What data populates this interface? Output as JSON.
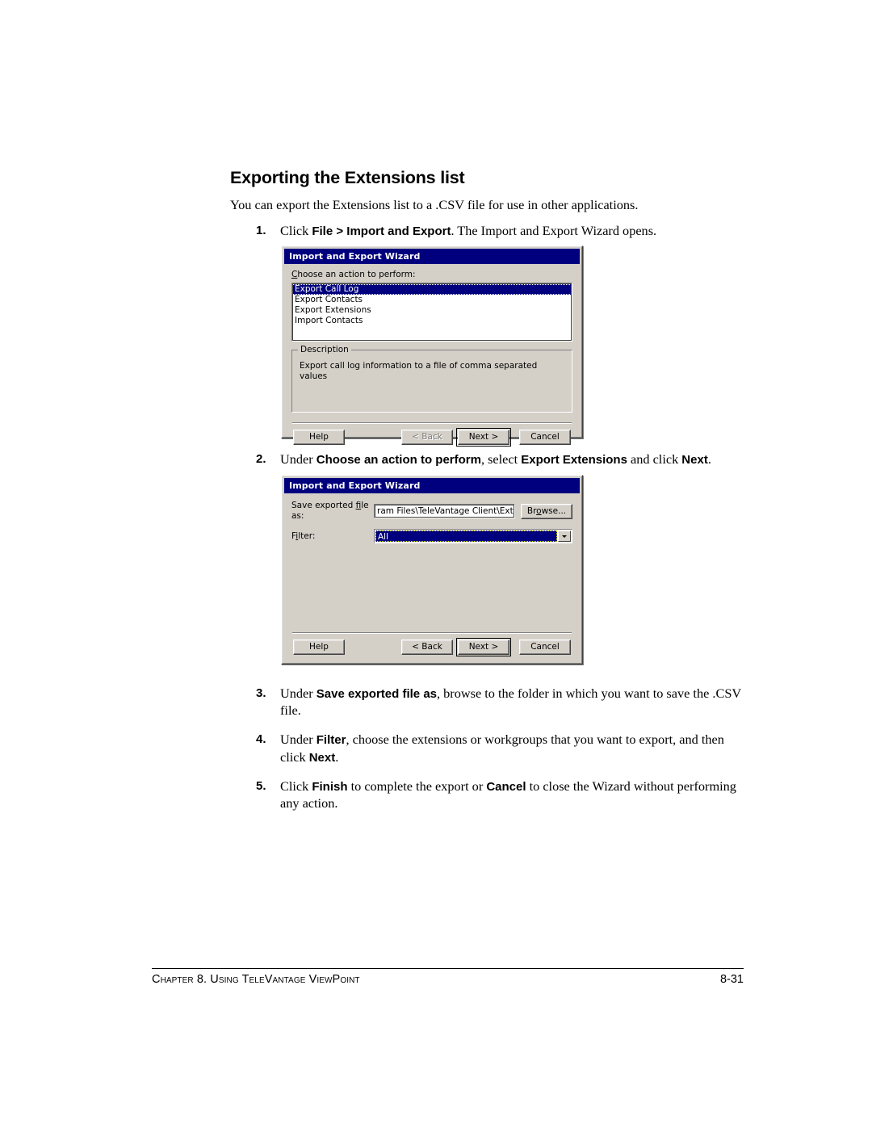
{
  "page": {
    "heading": "Exporting the Extensions list",
    "intro": "You can export the Extensions list to a .CSV file for use in other applications."
  },
  "steps": {
    "step1": {
      "num": "1.",
      "pre": "Click ",
      "bold1": "File > Import and Export",
      "post": ". The Import and Export Wizard opens."
    },
    "step2": {
      "num": "2.",
      "pre": "Under ",
      "bold1": "Choose an action to perform",
      "mid1": ", select ",
      "bold2": "Export Extensions",
      "mid2": " and click ",
      "bold3": "Next",
      "post": "."
    },
    "step3": {
      "num": "3.",
      "pre": "Under ",
      "bold1": "Save exported file as",
      "post": ", browse to the folder in which you want to save the .CSV file."
    },
    "step4": {
      "num": "4.",
      "pre": "Under ",
      "bold1": "Filter",
      "mid1": ", choose the extensions or workgroups that you want to export, and then click ",
      "bold2": "Next",
      "post": "."
    },
    "step5": {
      "num": "5.",
      "pre": "Click ",
      "bold1": "Finish",
      "mid1": " to complete the export or ",
      "bold2": "Cancel",
      "post": " to close the Wizard without performing any action."
    }
  },
  "dialog1": {
    "title": "Import and Export Wizard",
    "action_label": "Choose an action to perform:",
    "action_label_mnemonic": "C",
    "action_label_rest": "hoose an action to perform:",
    "list_items": [
      {
        "label": "Export Call Log",
        "selected": true
      },
      {
        "label": "Export Contacts",
        "selected": false
      },
      {
        "label": "Export Extensions",
        "selected": false
      },
      {
        "label": "Import Contacts",
        "selected": false
      }
    ],
    "description_title": "Description",
    "description_text": "Export call log information to a file of comma separated values",
    "buttons": {
      "help": "Help",
      "back": "< Back",
      "back_mnemonic": "B",
      "next": "Next >",
      "next_mnemonic": "N",
      "cancel": "Cancel"
    }
  },
  "dialog2": {
    "title": "Import and Export Wizard",
    "save_label_pre": "Save exported ",
    "save_label_mnemonic": "f",
    "save_label_post": "ile as:",
    "save_value": "ram Files\\TeleVantage Client\\Extensions.csv",
    "browse_pre": "Br",
    "browse_mnemonic": "o",
    "browse_post": "wse...",
    "filter_label_pre": "F",
    "filter_label_mnemonic": "i",
    "filter_label_post": "lter:",
    "filter_value": "All",
    "buttons": {
      "help": "Help",
      "back": "< Back",
      "back_mnemonic": "B",
      "next": "Next >",
      "next_mnemonic": "N",
      "cancel": "Cancel"
    }
  },
  "footer": {
    "chapter": "Chapter 8. Using TeleVantage ViewPoint",
    "page_number": "8-31"
  },
  "colors": {
    "titlebar": "#00007e",
    "dialog_face": "#d4d0c8",
    "selection": "#00007e",
    "disabled_text": "#808080"
  }
}
